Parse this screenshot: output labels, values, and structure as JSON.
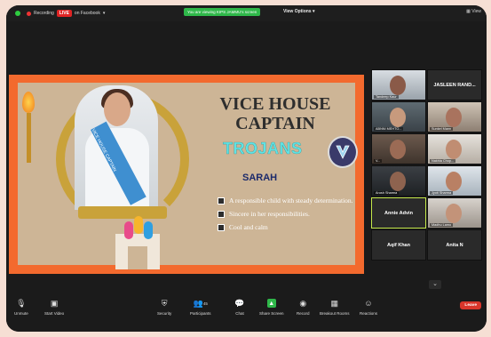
{
  "topbar": {
    "recording_label": "Recording",
    "live_label": "LIVE",
    "live_platform": "on Facebook",
    "share_banner": "You are viewing KIPS JAMMU's screen",
    "view_options": "View Options",
    "view_right": "View"
  },
  "slide": {
    "title": "VICE HOUSE CAPTAIN",
    "house": "TROJANS",
    "name": "SARAH",
    "sash_text": "VICE HOUSE CAPTAIN",
    "bullets": [
      "A responsible child with steady determination.",
      "Sincere in her responsibilities.",
      "Cool and calm"
    ]
  },
  "participants": [
    {
      "name": "Tandeep Kaur",
      "type": "video"
    },
    {
      "name": "JASLEEN RAND...",
      "type": "name"
    },
    {
      "name": "ABNNI MEHTO...",
      "type": "video"
    },
    {
      "name": "Sunkel Mann",
      "type": "video"
    },
    {
      "name": "V...",
      "type": "video"
    },
    {
      "name": "Nakhla Chop...",
      "type": "video"
    },
    {
      "name": "Arush Sharma",
      "type": "video"
    },
    {
      "name": "Jyoti Sharma",
      "type": "video"
    },
    {
      "name": "Annie Advin",
      "type": "name"
    },
    {
      "name": "Madhu Lamo",
      "type": "video"
    },
    {
      "name": "Aqif Khan",
      "type": "name"
    },
    {
      "name": "Anita N",
      "type": "name"
    }
  ],
  "toolbar": {
    "items": [
      "Unmute",
      "Start Video",
      "Security",
      "Participants",
      "Chat",
      "Share Screen",
      "Record",
      "Breakout Rooms",
      "Reactions"
    ],
    "participants_count": "45",
    "leave": "Leave"
  },
  "colors": {
    "slide_border": "#f36a2e",
    "slide_bg": "#cdb596",
    "trojans": "#5fe3e5",
    "share_green": "#2fb84a",
    "leave_red": "#d9362b",
    "active_speaker": "#c4e84a"
  }
}
